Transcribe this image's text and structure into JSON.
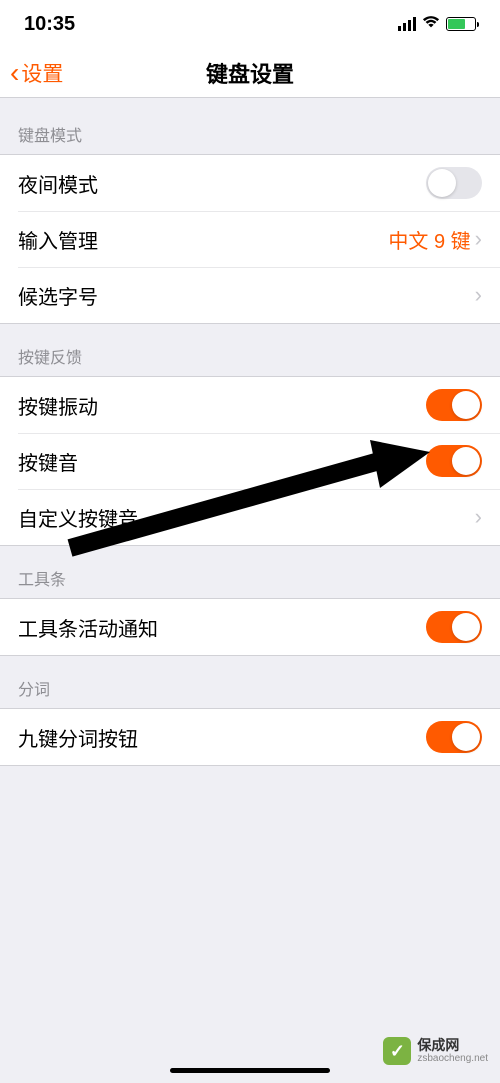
{
  "status": {
    "time": "10:35"
  },
  "nav": {
    "back": "设置",
    "title": "键盘设置"
  },
  "sections": {
    "mode": {
      "header": "键盘模式",
      "night": "夜间模式",
      "input_mgmt": "输入管理",
      "input_mgmt_value": "中文 9 键",
      "candidate": "候选字号"
    },
    "feedback": {
      "header": "按键反馈",
      "vibrate": "按键振动",
      "sound": "按键音",
      "custom_sound": "自定义按键音"
    },
    "toolbar": {
      "header": "工具条",
      "notify": "工具条活动通知"
    },
    "segment": {
      "header": "分词",
      "nine_key": "九键分词按钮"
    }
  },
  "watermark": {
    "title": "保成网",
    "url": "zsbaocheng.net"
  }
}
